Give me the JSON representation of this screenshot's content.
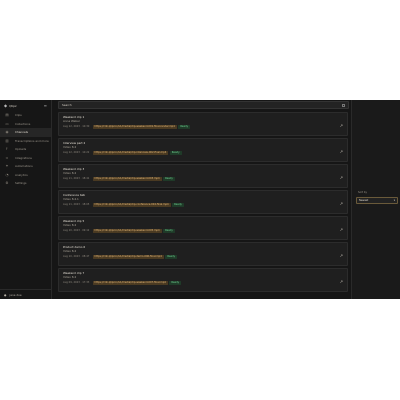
{
  "app": {
    "title": "Qlipz",
    "footer_user": "jane doe"
  },
  "sidebar": {
    "items": [
      {
        "label": "Clips",
        "icon": "clip-icon"
      },
      {
        "label": "Collections",
        "icon": "folder-icon"
      },
      {
        "label": "Channels",
        "icon": "channel-icon"
      },
      {
        "label": "Transcriptions and more",
        "icon": "doc-icon"
      },
      {
        "label": "Uploads",
        "icon": "upload-icon"
      },
      {
        "label": "Integrations",
        "icon": "link-icon"
      },
      {
        "label": "Automations",
        "icon": "bolt-icon"
      },
      {
        "label": "Analytics",
        "icon": "chart-icon"
      },
      {
        "label": "Settings",
        "icon": "gear-icon"
      }
    ]
  },
  "search": {
    "value": "Search"
  },
  "cards": [
    {
      "title": "Weekend clip 1",
      "user": "Anna Weber",
      "date": "Aug 12, 2023 · 10:30",
      "tag": "https://cdn.qlipz.io/v1/media/clip-weekend-001-final-render.mp4",
      "status": "Ready"
    },
    {
      "title": "Interview part 2",
      "user": "Video 8.4",
      "date": "Aug 12, 2023 · 10:22",
      "tag": "https://cdn.qlipz.io/v1/media/clip-interview-002-final.mp4",
      "status": "Ready"
    },
    {
      "title": "Weekend clip 3",
      "user": "Video 8.4",
      "date": "Aug 11, 2023 · 18:41",
      "tag": "https://cdn.qlipz.io/v1/media/clip-weekend-003.mp4",
      "status": "Ready"
    },
    {
      "title": "Conference talk",
      "user": "Video 8.4.1",
      "date": "Aug 11, 2023 · 18:05",
      "tag": "https://cdn.qlipz.io/v1/media/clip-conference-004-final.mp4",
      "status": "Ready"
    },
    {
      "title": "Weekend clip 5",
      "user": "Video 8.4",
      "date": "Aug 10, 2023 · 09:12",
      "tag": "https://cdn.qlipz.io/v1/media/clip-weekend-005.mp4",
      "status": "Ready"
    },
    {
      "title": "Product demo 6",
      "user": "Video 8.4",
      "date": "Aug 10, 2023 · 08:47",
      "tag": "https://cdn.qlipz.io/v1/media/clip-demo-006-final.mp4",
      "status": "Ready"
    },
    {
      "title": "Weekend clip 7",
      "user": "Video 8.4",
      "date": "Aug 09, 2023 · 17:33",
      "tag": "https://cdn.qlipz.io/v1/media/clip-weekend-007-final.mp4",
      "status": "Ready"
    }
  ],
  "right_panel": {
    "label": "Sort by",
    "select_value": "Newest"
  },
  "colors": {
    "background": "#161616",
    "card": "#1f1f1f",
    "tag_bg": "#4a3a22",
    "tag_fg": "#e5b878",
    "ok_bg": "#1f3a28",
    "ok_fg": "#6fd091"
  }
}
